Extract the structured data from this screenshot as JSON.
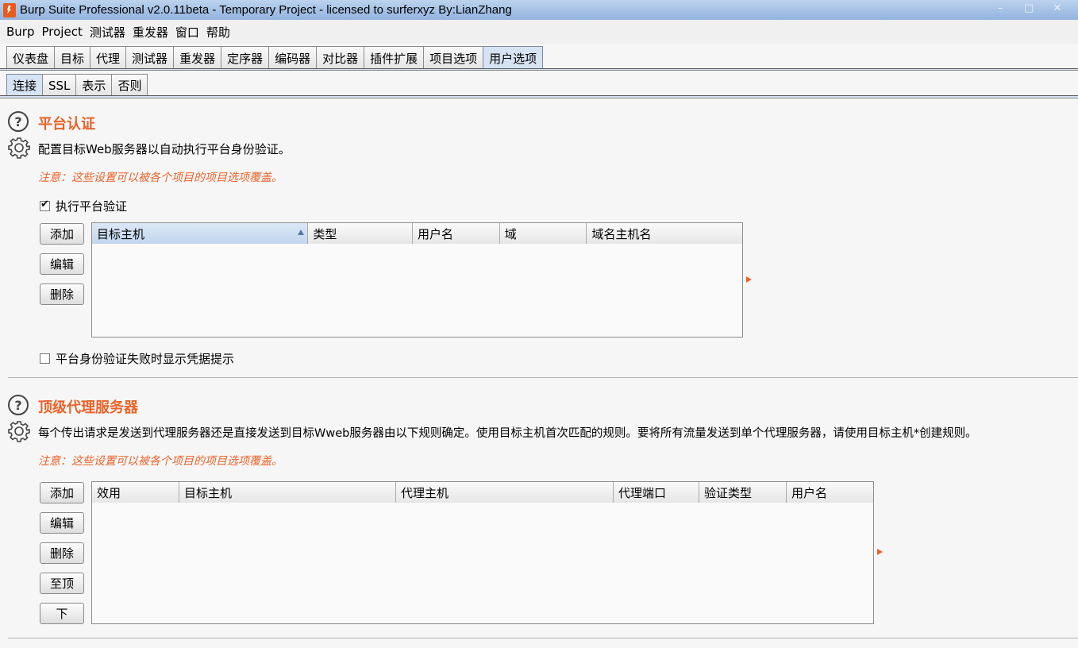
{
  "window": {
    "title": "Burp Suite Professional v2.0.11beta - Temporary Project - licensed to surferxyz By:LianZhang",
    "controls": [
      "–",
      "□",
      "✕"
    ]
  },
  "menubar": {
    "items": [
      "Burp",
      "Project",
      "测试器",
      "重发器",
      "窗口",
      "帮助"
    ]
  },
  "main_tabs": {
    "items": [
      "仪表盘",
      "目标",
      "代理",
      "测试器",
      "重发器",
      "定序器",
      "编码器",
      "对比器",
      "插件扩展",
      "项目选项",
      "用户选项"
    ],
    "active": "用户选项"
  },
  "sub_tabs": {
    "items": [
      "连接",
      "SSL",
      "表示",
      "否则"
    ],
    "active": "连接"
  },
  "platform_auth": {
    "title": "平台认证",
    "description": "配置目标Web服务器以自动执行平台身份验证。",
    "note": "注意：这些设置可以被各个项目的项目选项覆盖。",
    "enable_label": "执行平台验证",
    "enable_checked": true,
    "buttons": {
      "add": "添加",
      "edit": "编辑",
      "remove": "删除"
    },
    "columns": [
      "目标主机",
      "类型",
      "用户名",
      "域",
      "域名主机名"
    ],
    "rows": [],
    "prompt_label": "平台身份验证失败时显示凭据提示",
    "prompt_checked": false
  },
  "upstream_proxy": {
    "title": "顶级代理服务器",
    "description": "每个传出请求是发送到代理服务器还是直接发送到目标Wweb服务器由以下规则确定。使用目标主机首次匹配的规则。要将所有流量发送到单个代理服务器，请使用目标主机*创建规则。",
    "note": "注意：这些设置可以被各个项目的项目选项覆盖。",
    "buttons": {
      "add": "添加",
      "edit": "编辑",
      "remove": "删除",
      "up": "至顶",
      "down": "下"
    },
    "columns": [
      "效用",
      "目标主机",
      "代理主机",
      "代理端口",
      "验证类型",
      "用户名"
    ],
    "rows": []
  },
  "colors": {
    "accent": "#e8632a",
    "active_tab": "#d6e3f2"
  }
}
